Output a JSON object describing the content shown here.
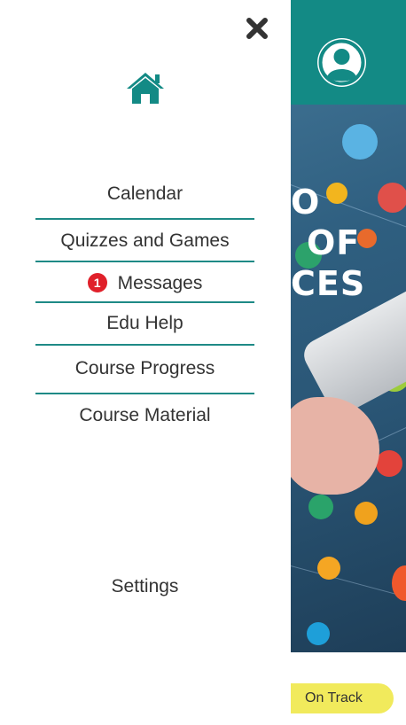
{
  "drawer": {
    "menu": [
      {
        "label": "Calendar"
      },
      {
        "label": "Quizzes and Games"
      },
      {
        "label": "Messages",
        "badge": "1"
      },
      {
        "label": "Edu Help"
      },
      {
        "label": "Course Progress"
      },
      {
        "label": "Course Material"
      }
    ],
    "settings_label": "Settings"
  },
  "background": {
    "hero_text": [
      "O",
      "OF",
      "CES"
    ]
  },
  "status": {
    "label": "On Track"
  },
  "colors": {
    "accent": "#138a85",
    "badge": "#e0202a",
    "status_pill": "#f1ea5c"
  },
  "icons": [
    "close-icon",
    "home-icon",
    "user-avatar-icon"
  ]
}
